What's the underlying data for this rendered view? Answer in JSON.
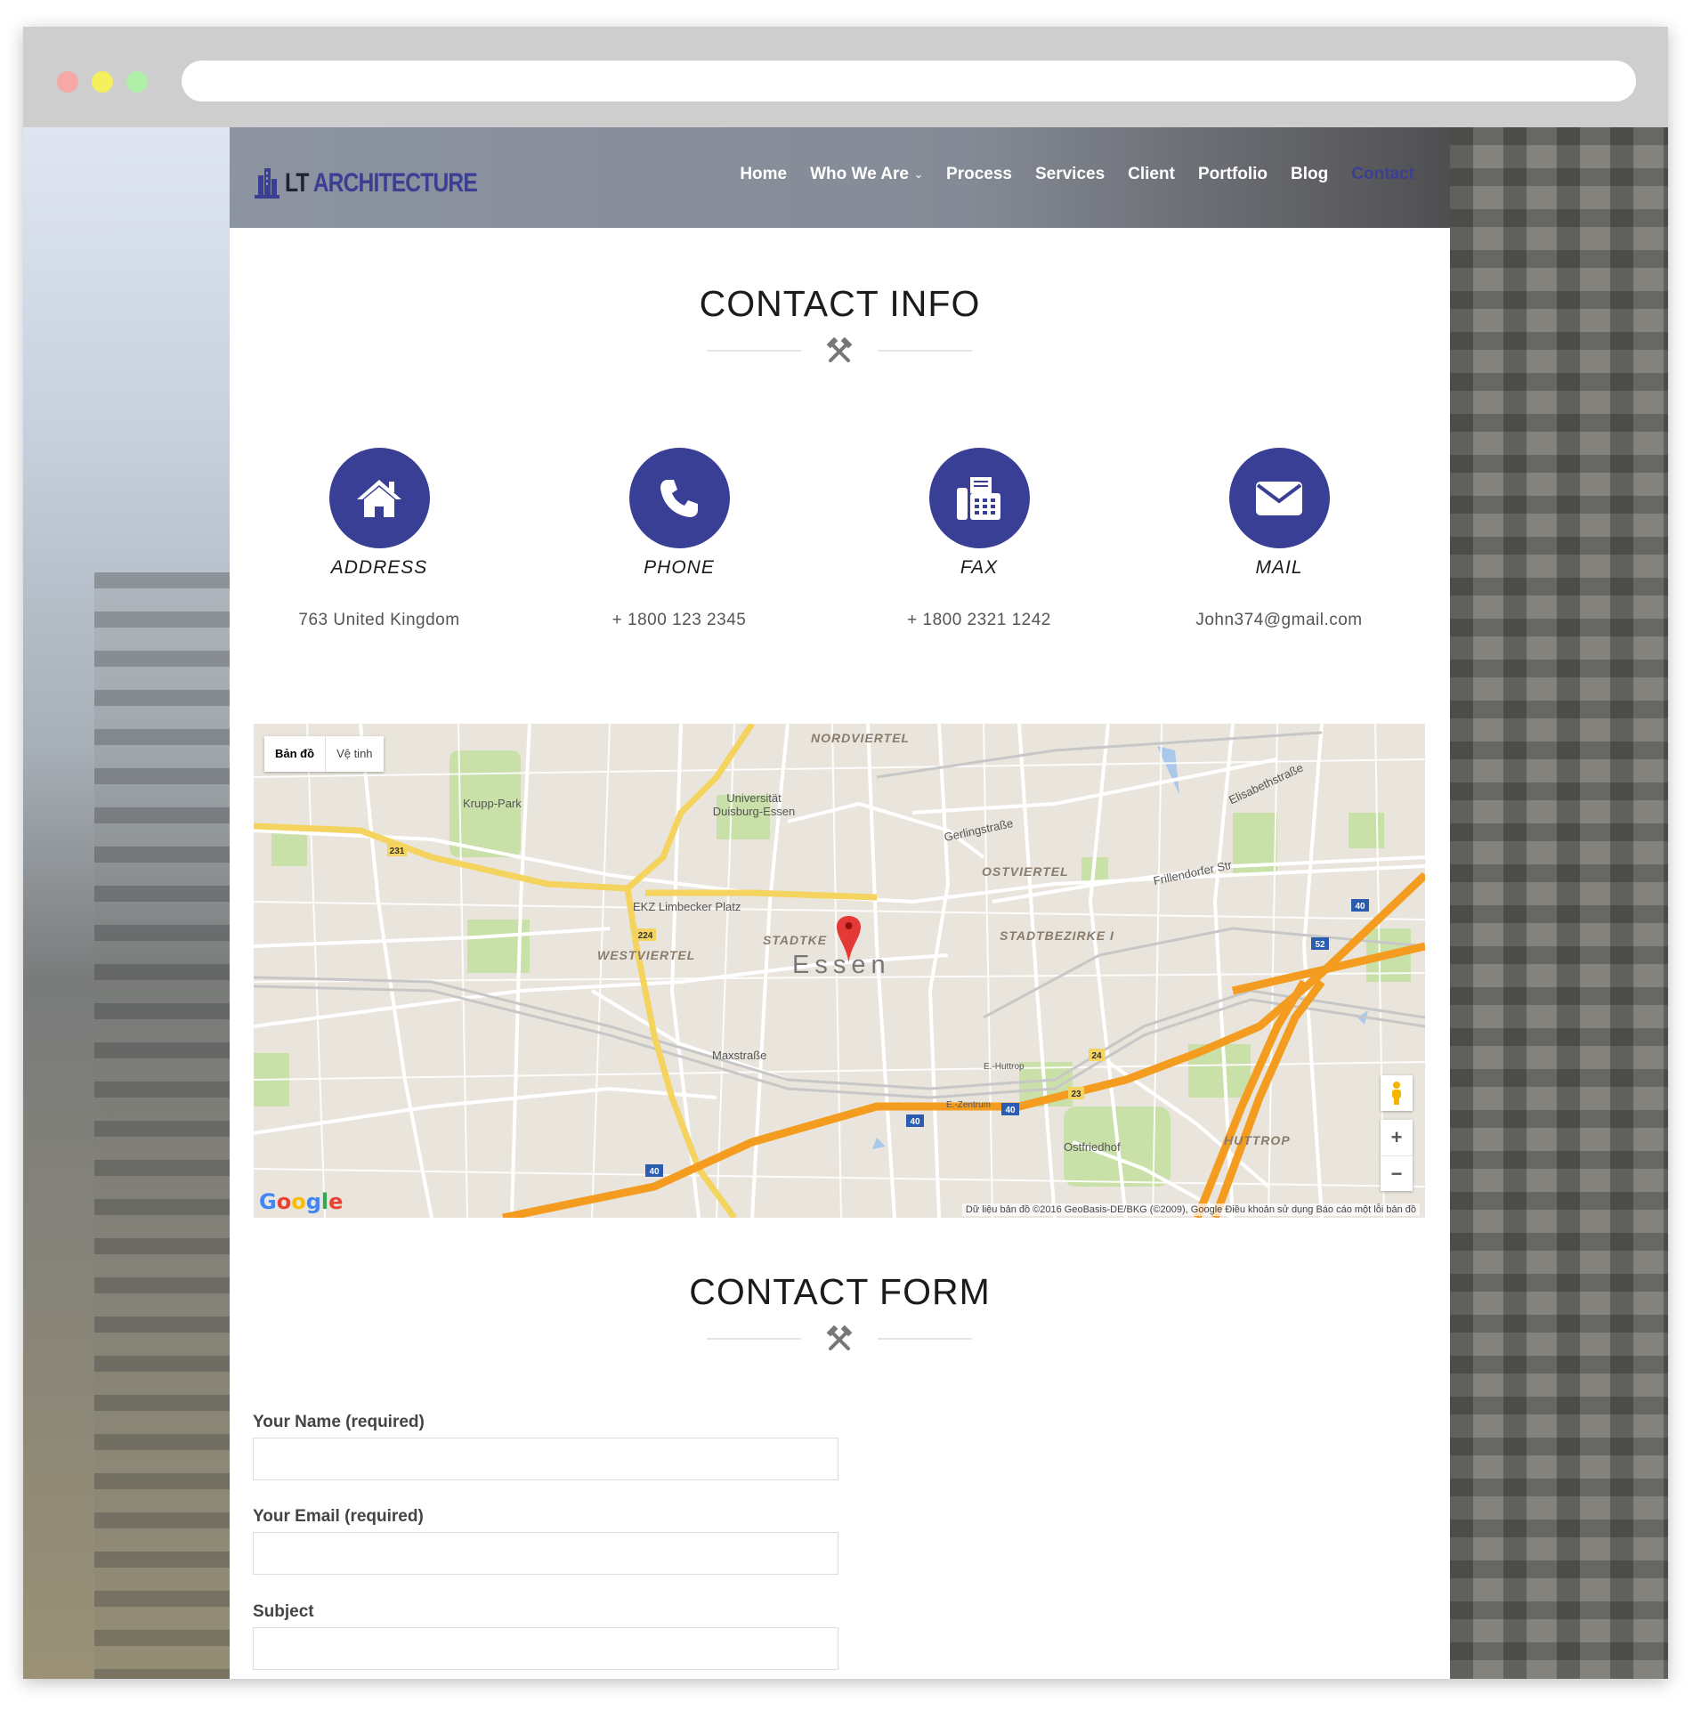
{
  "site": {
    "logo_lt": "LT",
    "logo_arch": "ARCHITECTURE"
  },
  "nav": {
    "items": [
      {
        "label": "Home",
        "active": false,
        "dropdown": false
      },
      {
        "label": "Who We Are",
        "active": false,
        "dropdown": true
      },
      {
        "label": "Process",
        "active": false,
        "dropdown": false
      },
      {
        "label": "Services",
        "active": false,
        "dropdown": false
      },
      {
        "label": "Client",
        "active": false,
        "dropdown": false
      },
      {
        "label": "Portfolio",
        "active": false,
        "dropdown": false
      },
      {
        "label": "Blog",
        "active": false,
        "dropdown": false
      },
      {
        "label": "Contact",
        "active": true,
        "dropdown": false
      }
    ]
  },
  "contact_info": {
    "title": "CONTACT INFO",
    "items": [
      {
        "label": "ADDRESS",
        "value": "763 United Kingdom",
        "icon": "home-icon"
      },
      {
        "label": "PHONE",
        "value": "+ 1800 123 2345",
        "icon": "phone-icon"
      },
      {
        "label": "FAX",
        "value": "+ 1800 2321 1242",
        "icon": "fax-icon"
      },
      {
        "label": "MAIL",
        "value": "John374@gmail.com",
        "icon": "mail-icon"
      }
    ]
  },
  "map": {
    "tab_map": "Bản đồ",
    "tab_satellite": "Vệ tinh",
    "google": "Google",
    "credit": "Dữ liệu bản đồ ©2016 GeoBasis-DE/BKG (©2009), Google   Điều khoản sử dụng   Báo cáo một lỗi bản đồ",
    "zoom_in": "+",
    "zoom_out": "−",
    "labels": {
      "city": "Essen",
      "nordviertel": "NORDVIERTEL",
      "ostviertel": "OSTVIERTEL",
      "westviertel": "WESTVIERTEL",
      "stadtkern": "STADTKE",
      "stadtbezirke": "STADTBEZIRKE I",
      "huttrop": "HUTTROP",
      "uni": "Universität Duisburg-Essen",
      "krupp": "Krupp-Park",
      "ekz": "EKZ Limbecker Platz",
      "gerling": "Gerlingstraße",
      "frillendorfer": "Frillendorfer Str",
      "elisabeth": "Elisabethstraße",
      "maxstr": "Maxstraße",
      "ostfriedhof": "Ostfriedhof",
      "huttropexit": "E.-Huttrop",
      "zentrum": "E.-Zentrum"
    },
    "colors": {
      "motorway": "#f39c1f",
      "primary": "#f4d35e",
      "park": "#c9e0a8",
      "water": "#a9c8ea",
      "marker": "#e53935"
    }
  },
  "contact_form": {
    "title": "CONTACT FORM",
    "fields": [
      {
        "label": "Your Name (required)",
        "value": ""
      },
      {
        "label": "Your Email (required)",
        "value": ""
      },
      {
        "label": "Subject",
        "value": ""
      }
    ]
  },
  "colors": {
    "accent": "#3a3f96",
    "text": "#1b1b1b"
  }
}
